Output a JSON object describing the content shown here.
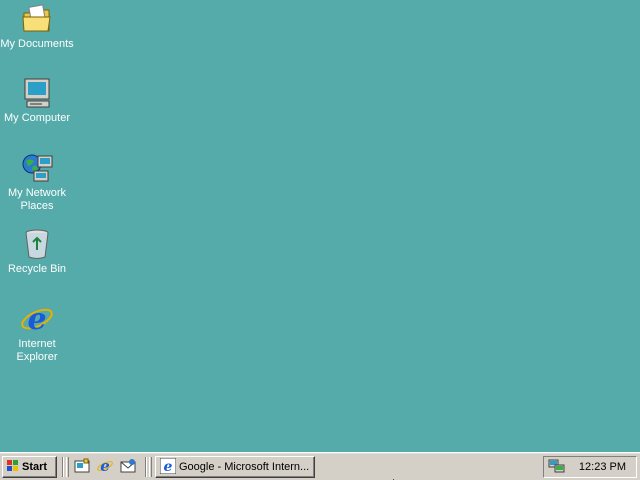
{
  "desktop": {
    "background": "#55aaaa",
    "icons": [
      {
        "label": "My Documents",
        "icon": "folder-documents-icon"
      },
      {
        "label": "My Computer",
        "icon": "computer-icon"
      },
      {
        "label": "My Network Places",
        "icon": "network-places-icon"
      },
      {
        "label": "Recycle Bin",
        "icon": "recycle-bin-icon"
      },
      {
        "label": "Internet Explorer",
        "icon": "internet-explorer-icon"
      }
    ]
  },
  "taskbar": {
    "start_label": "Start",
    "quick_launch": [
      {
        "icon": "show-desktop-icon"
      },
      {
        "icon": "internet-explorer-icon"
      },
      {
        "icon": "outlook-express-icon"
      }
    ],
    "tasks": [
      {
        "label": "Google - Microsoft Intern...",
        "icon": "internet-explorer-icon"
      }
    ],
    "tray": {
      "icons": [
        {
          "icon": "network-connection-icon"
        }
      ],
      "clock": "12:23 PM"
    }
  }
}
